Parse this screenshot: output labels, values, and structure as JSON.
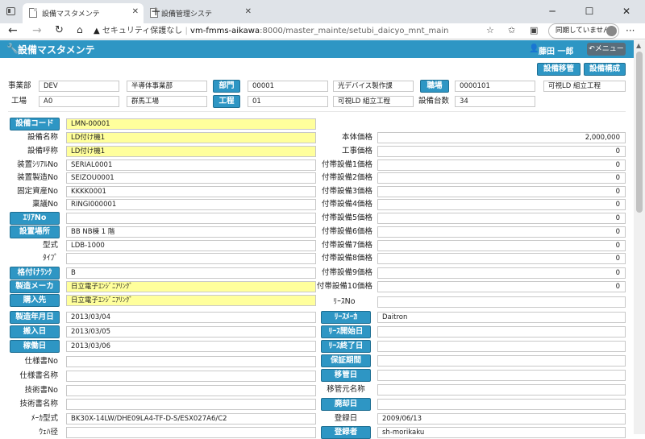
{
  "browser": {
    "tabs": [
      {
        "title": "設備マスタメンテ"
      },
      {
        "title": "設備管理システ"
      }
    ],
    "security": "セキュリティ保護なし",
    "url_host": "vm-fmms-aikawa",
    "url_path": ":8000/master_mainte/setubi_daicyo_mnt_main",
    "sync_label": "同期していません"
  },
  "app": {
    "title": "設備マスタメンテ",
    "user": "藤田 一郎",
    "menu_label": "メニュー",
    "buttons": {
      "transfer": "設備移管",
      "config": "設備構成"
    }
  },
  "header": {
    "jigyobu_label": "事業部",
    "jigyobu_code": "DEV",
    "jigyobu_name": "半導体事業部",
    "bumon_btn": "部門",
    "bumon_code": "00001",
    "bumon_name": "光デバイス製作課",
    "shokuba_btn": "職場",
    "shokuba_code": "0000101",
    "shokuba_name": "可視LD 組立工程",
    "kojo_label": "工場",
    "kojo_code": "A0",
    "kojo_name": "群馬工場",
    "kotei_btn": "工程",
    "kotei_code": "01",
    "kotei_name": "可視LD 組立工程",
    "daisu_label": "設備台数",
    "daisu_value": "34"
  },
  "left": {
    "code_btn": "設備コード",
    "code": "LMN-00001",
    "meisho_label": "設備名称",
    "meisho": "LD付け機1",
    "kosho_label": "設備呼称",
    "kosho": "LD付け機1",
    "serial_label": "装置ｼﾘｱﾙNo",
    "serial": "SERIAL0001",
    "seizo_label": "装置製造No",
    "seizo": "SEIZOU0001",
    "shisan_label": "固定資産No",
    "shisan": "KKKK0001",
    "ringi_label": "稟議No",
    "ringi": "RINGI000001",
    "area_btn": "ｴﾘｱNo",
    "area": "",
    "basho_btn": "設置場所",
    "basho": "BB NB棟 1 階",
    "kata_label": "型式",
    "kata": "LDB-1000",
    "type_label": "ﾀｲﾌﾟ",
    "type": "",
    "rank_btn": "格付けﾗﾝｸ",
    "rank": "B",
    "maker_btn": "製造メーカ",
    "maker": "日立電子ｴﾝｼﾞﾆｱﾘﾝｸﾞ",
    "kounyu_btn": "購入先",
    "kounyu": "日立電子ｴﾝｼﾞﾆｱﾘﾝｸﾞ",
    "seizobi_btn": "製造年月日",
    "seizobi": "2013/03/04",
    "hannyu_btn": "搬入日",
    "hannyu": "2013/03/05",
    "kado_btn": "稼働日",
    "kado": "2013/03/06",
    "shiyo_no_label": "仕様書No",
    "shiyo_no": "",
    "shiyo_mei_label": "仕様書名称",
    "shiyo_mei": "",
    "gijutsu_no_label": "技術書No",
    "gijutsu_no": "",
    "gijutsu_mei_label": "技術書名称",
    "gijutsu_mei": "",
    "maker_kata_label": "ﾒｰｶ型式",
    "maker_kata": "BK30X-14LW/DHE09LA4-TF-D-S/ESX027A6/C2",
    "wafer_label": "ｳｪﾊ径",
    "wafer": ""
  },
  "right": {
    "honTai_label": "本体価格",
    "honTai": "2,000,000",
    "koji_label": "工事価格",
    "koji": "0",
    "futai": [
      {
        "label": "付帯設備1価格",
        "value": "0"
      },
      {
        "label": "付帯設備2価格",
        "value": "0"
      },
      {
        "label": "付帯設備3価格",
        "value": "0"
      },
      {
        "label": "付帯設備4価格",
        "value": "0"
      },
      {
        "label": "付帯設備5価格",
        "value": "0"
      },
      {
        "label": "付帯設備6価格",
        "value": "0"
      },
      {
        "label": "付帯設備7価格",
        "value": "0"
      },
      {
        "label": "付帯設備8価格",
        "value": "0"
      },
      {
        "label": "付帯設備9価格",
        "value": "0"
      },
      {
        "label": "付帯設備10価格",
        "value": "0"
      }
    ],
    "lease_no_label": "ﾘｰｽNo",
    "lease_no": "",
    "lease_maker_btn": "ﾘｰｽﾒｰｶ",
    "lease_maker": "Daitron",
    "lease_start_btn": "ﾘｰｽ開始日",
    "lease_start": "",
    "lease_end_btn": "ﾘｰｽ終了日",
    "lease_end": "",
    "hosho_btn": "保証期間",
    "hosho": "",
    "ikan_btn": "移管日",
    "ikan": "",
    "ikanmoto_label": "移管元名称",
    "ikanmoto": "",
    "haikyaku_btn": "廃却日",
    "haikyaku": "",
    "toroku_label": "登録日",
    "toroku": "2009/06/13",
    "torokusha_btn": "登録者",
    "torokusha": "sh-morikaku"
  }
}
